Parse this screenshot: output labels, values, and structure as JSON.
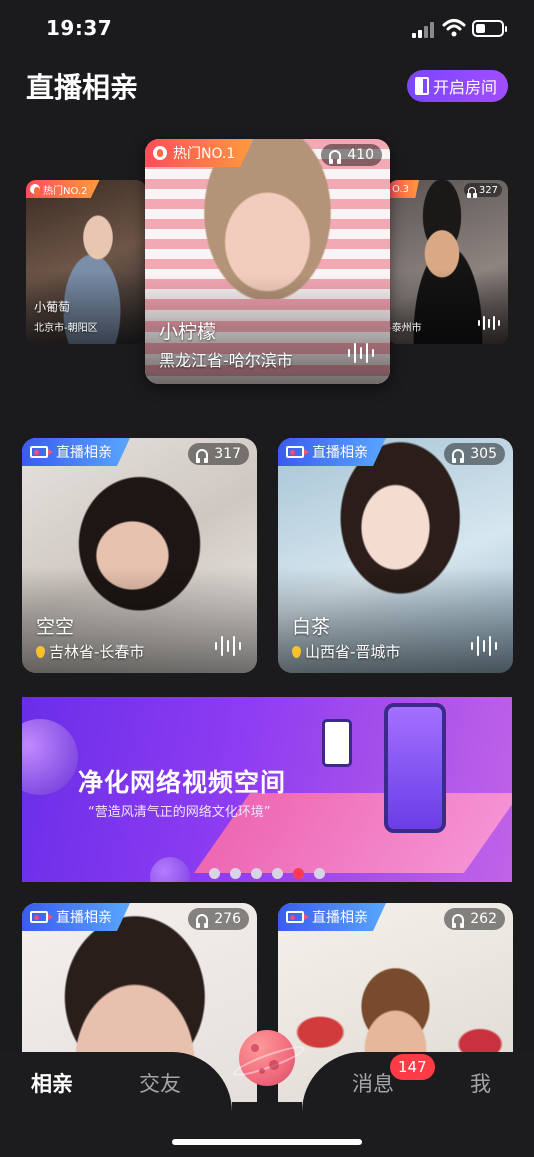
{
  "status": {
    "time": "19:37"
  },
  "header": {
    "title": "直播相亲",
    "open_room_label": "开启房间"
  },
  "carousel": {
    "left": {
      "tag": "热门NO.2",
      "name": "小葡萄",
      "location": "北京市-朝阳区"
    },
    "center": {
      "tag": "热门NO.1",
      "viewers": "410",
      "name": "小柠檬",
      "location": "黑龙江省-哈尔滨市"
    },
    "right": {
      "tag": "O.3",
      "viewers": "327",
      "location": "-泰州市"
    }
  },
  "grid": [
    {
      "tag": "直播相亲",
      "viewers": "317",
      "name": "空空",
      "location": "吉林省-长春市"
    },
    {
      "tag": "直播相亲",
      "viewers": "305",
      "name": "白茶",
      "location": "山西省-晋城市"
    },
    {
      "tag": "直播相亲",
      "viewers": "276"
    },
    {
      "tag": "直播相亲",
      "viewers": "262"
    }
  ],
  "banner": {
    "title": "净化网络视频空间",
    "subtitle": "“营造风清气正的网络文化环境”",
    "dot_count": 6,
    "active_dot": 4
  },
  "tabbar": {
    "tabs": [
      "相亲",
      "交友",
      "消息",
      "我"
    ],
    "active": "相亲",
    "message_badge": "147"
  },
  "colors": {
    "accent": "#7b46ff",
    "badge": "#ff3b45",
    "background": "#1b1b1d"
  }
}
